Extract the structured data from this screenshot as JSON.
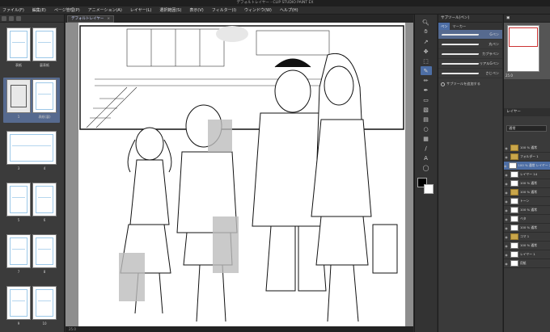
{
  "window": {
    "title": "デフォルトレイヤー - CLIP STUDIO PAINT EX"
  },
  "menu": [
    "ファイル(F)",
    "編集(E)",
    "ページ管理(P)",
    "アニメーション(A)",
    "レイヤー(L)",
    "選択範囲(S)",
    "表示(V)",
    "フィルター(I)",
    "ウィンドウ(W)",
    "ヘルプ(H)"
  ],
  "document_tab": {
    "label": "デフォルトレイヤー",
    "close": "×"
  },
  "pages": {
    "spreads": [
      {
        "left": "表紙",
        "right": "裏表紙"
      },
      {
        "left": "1",
        "right": "表紙(裏)"
      },
      {
        "left": "3",
        "right": "4"
      },
      {
        "left": "5",
        "right": "6"
      },
      {
        "left": "7",
        "right": "8"
      },
      {
        "left": "9",
        "right": "10"
      }
    ]
  },
  "subtool": {
    "header": "サブツール[ペン]",
    "tabs": [
      "ペン",
      "マーカー"
    ],
    "brushes": [
      "Gペン",
      "丸ペン",
      "カブラペン",
      "リアルGペン",
      "さじペン"
    ],
    "add_label": "サブツールを追加する"
  },
  "navigator": {
    "zoom": "25.0"
  },
  "layer_panel": {
    "header": "レイヤー",
    "blend_mode": "通常",
    "layers": [
      {
        "name": "100 % 通常",
        "folder": true
      },
      {
        "name": "フォルダー 1",
        "folder": true
      },
      {
        "name": "100 % 通常 レイヤー 2",
        "folder": false,
        "selected": true
      },
      {
        "name": "レイヤー 14",
        "folder": false
      },
      {
        "name": "100 % 通常",
        "folder": false
      },
      {
        "name": "100 % 通常",
        "folder": true
      },
      {
        "name": "トーン",
        "folder": false
      },
      {
        "name": "100 % 通常",
        "folder": false
      },
      {
        "name": "ベタ",
        "folder": false
      },
      {
        "name": "100 % 通常",
        "folder": false
      },
      {
        "name": "コマ 1",
        "folder": true
      },
      {
        "name": "100 % 通常",
        "folder": false
      },
      {
        "name": "レイヤー 1",
        "folder": false
      },
      {
        "name": "用紙",
        "folder": false
      }
    ]
  },
  "status": {
    "zoom": "25.0"
  },
  "colors": {
    "accent": "#4d6ea5",
    "panel": "#3a3a3a",
    "canvas_bg": "#8e8e8e"
  },
  "icons": [
    "zoom-icon",
    "hand-icon",
    "eyedropper-icon",
    "pen-icon",
    "pencil-icon",
    "brush-icon",
    "eraser-icon",
    "fill-icon",
    "gradient-icon",
    "figure-icon",
    "frame-icon",
    "ruler-icon",
    "text-icon",
    "balloon-icon",
    "select-icon",
    "move-icon"
  ]
}
